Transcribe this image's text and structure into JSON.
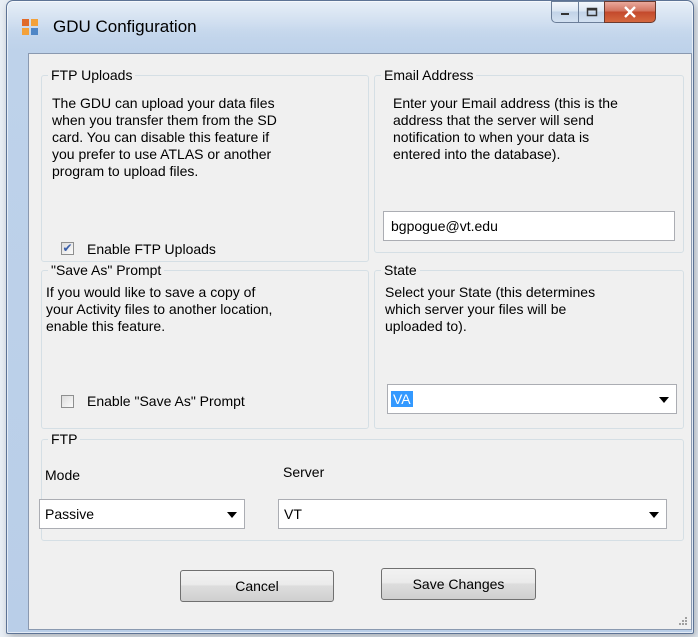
{
  "window": {
    "title": "GDU Configuration"
  },
  "ftp_uploads": {
    "legend": "FTP Uploads",
    "description_lines": [
      "The GDU can upload your data files",
      "when you transfer them from the SD",
      "card.  You can disable this feature if",
      "you prefer to use ATLAS or another",
      "program to upload files."
    ],
    "checkbox_label": "Enable FTP Uploads",
    "checked": true
  },
  "email": {
    "legend": "Email Address",
    "description_lines": [
      "Enter your Email address (this is the",
      "address that the server will send",
      "notification to when your data is",
      "entered into the database)."
    ],
    "value": "bgpogue@vt.edu"
  },
  "save_as": {
    "legend": "\"Save As\" Prompt",
    "description_lines": [
      "If you would like to save a copy of",
      "your Activity files to another location,",
      "enable this feature."
    ],
    "checkbox_label": "Enable \"Save As\" Prompt",
    "checked": false
  },
  "state": {
    "legend": "State",
    "description_lines": [
      "Select your State (this determines",
      "which server your files will be",
      "uploaded to)."
    ],
    "selected": "VA"
  },
  "ftp": {
    "legend": "FTP",
    "mode_label": "Mode",
    "mode_value": "Passive",
    "server_label": "Server",
    "server_value": "VT"
  },
  "buttons": {
    "cancel": "Cancel",
    "save": "Save Changes"
  },
  "colors": {
    "selection": "#3399ff",
    "window_frame": "#b9cee8",
    "close_button": "#c3492c"
  }
}
